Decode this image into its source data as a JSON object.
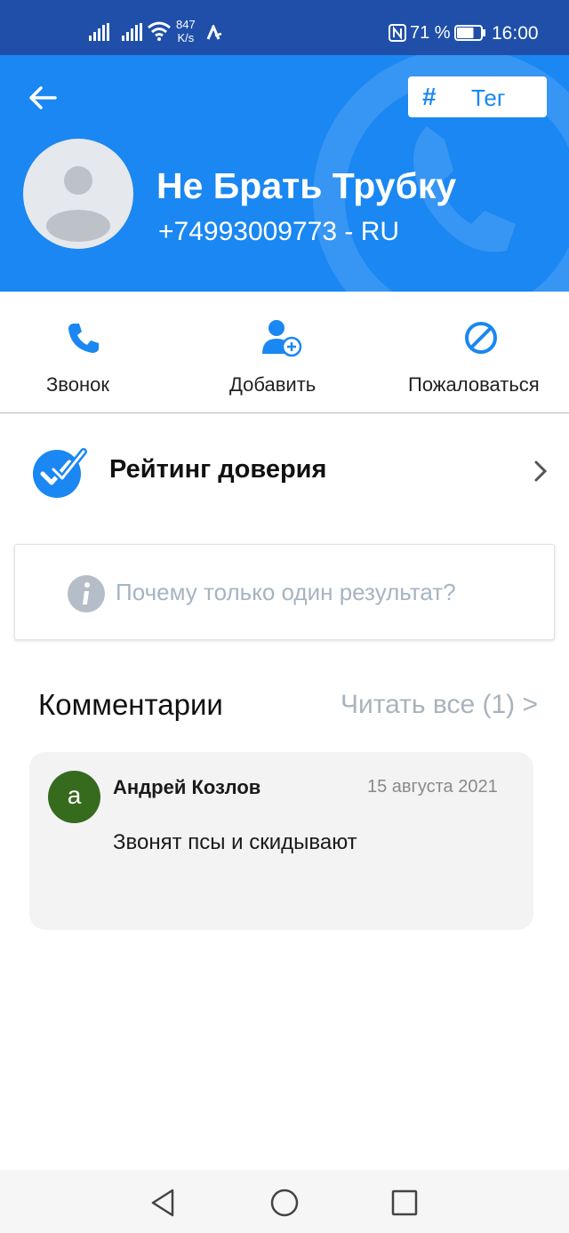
{
  "status_bar": {
    "net_speed_value": "847",
    "net_speed_unit": "K/s",
    "battery_percent": "71 %",
    "battery_level": 0.71,
    "time": "16:00"
  },
  "header": {
    "tag_hash": "#",
    "tag_label": "Тег",
    "contact_name": "Не Брать Трубку",
    "contact_phone": "+74993009773 - RU"
  },
  "actions": {
    "call_label": "Звонок",
    "add_label": "Добавить",
    "report_label": "Пожаловаться"
  },
  "rating": {
    "label": "Рейтинг доверия"
  },
  "info": {
    "text": "Почему только один результат?"
  },
  "comments": {
    "title": "Комментарии",
    "read_all": "Читать все (1) >",
    "items": [
      {
        "avatar_letter": "a",
        "author": "Андрей Козлов",
        "date": "15 августа 2021",
        "text": "Звонят псы и скидывают"
      }
    ]
  },
  "colors": {
    "status_bar": "#1f4fa8",
    "header": "#1a87f2",
    "accent": "#1a87f2",
    "comment_avatar": "#366a1d"
  },
  "icons": {
    "back": "arrow-left-icon",
    "call": "phone-icon",
    "add": "add-contact-icon",
    "report": "block-icon",
    "rating": "check-shield-icon",
    "info": "info-icon",
    "chevron": "chevron-right-icon"
  }
}
